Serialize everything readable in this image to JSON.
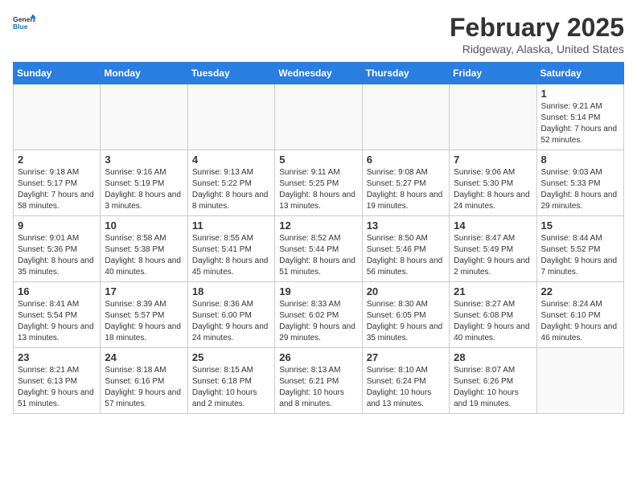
{
  "header": {
    "logo_general": "General",
    "logo_blue": "Blue",
    "month_year": "February 2025",
    "location": "Ridgeway, Alaska, United States"
  },
  "days_of_week": [
    "Sunday",
    "Monday",
    "Tuesday",
    "Wednesday",
    "Thursday",
    "Friday",
    "Saturday"
  ],
  "weeks": [
    [
      {
        "day": "",
        "info": ""
      },
      {
        "day": "",
        "info": ""
      },
      {
        "day": "",
        "info": ""
      },
      {
        "day": "",
        "info": ""
      },
      {
        "day": "",
        "info": ""
      },
      {
        "day": "",
        "info": ""
      },
      {
        "day": "1",
        "info": "Sunrise: 9:21 AM\nSunset: 5:14 PM\nDaylight: 7 hours and 52 minutes."
      }
    ],
    [
      {
        "day": "2",
        "info": "Sunrise: 9:18 AM\nSunset: 5:17 PM\nDaylight: 7 hours and 58 minutes."
      },
      {
        "day": "3",
        "info": "Sunrise: 9:16 AM\nSunset: 5:19 PM\nDaylight: 8 hours and 3 minutes."
      },
      {
        "day": "4",
        "info": "Sunrise: 9:13 AM\nSunset: 5:22 PM\nDaylight: 8 hours and 8 minutes."
      },
      {
        "day": "5",
        "info": "Sunrise: 9:11 AM\nSunset: 5:25 PM\nDaylight: 8 hours and 13 minutes."
      },
      {
        "day": "6",
        "info": "Sunrise: 9:08 AM\nSunset: 5:27 PM\nDaylight: 8 hours and 19 minutes."
      },
      {
        "day": "7",
        "info": "Sunrise: 9:06 AM\nSunset: 5:30 PM\nDaylight: 8 hours and 24 minutes."
      },
      {
        "day": "8",
        "info": "Sunrise: 9:03 AM\nSunset: 5:33 PM\nDaylight: 8 hours and 29 minutes."
      }
    ],
    [
      {
        "day": "9",
        "info": "Sunrise: 9:01 AM\nSunset: 5:36 PM\nDaylight: 8 hours and 35 minutes."
      },
      {
        "day": "10",
        "info": "Sunrise: 8:58 AM\nSunset: 5:38 PM\nDaylight: 8 hours and 40 minutes."
      },
      {
        "day": "11",
        "info": "Sunrise: 8:55 AM\nSunset: 5:41 PM\nDaylight: 8 hours and 45 minutes."
      },
      {
        "day": "12",
        "info": "Sunrise: 8:52 AM\nSunset: 5:44 PM\nDaylight: 8 hours and 51 minutes."
      },
      {
        "day": "13",
        "info": "Sunrise: 8:50 AM\nSunset: 5:46 PM\nDaylight: 8 hours and 56 minutes."
      },
      {
        "day": "14",
        "info": "Sunrise: 8:47 AM\nSunset: 5:49 PM\nDaylight: 9 hours and 2 minutes."
      },
      {
        "day": "15",
        "info": "Sunrise: 8:44 AM\nSunset: 5:52 PM\nDaylight: 9 hours and 7 minutes."
      }
    ],
    [
      {
        "day": "16",
        "info": "Sunrise: 8:41 AM\nSunset: 5:54 PM\nDaylight: 9 hours and 13 minutes."
      },
      {
        "day": "17",
        "info": "Sunrise: 8:39 AM\nSunset: 5:57 PM\nDaylight: 9 hours and 18 minutes."
      },
      {
        "day": "18",
        "info": "Sunrise: 8:36 AM\nSunset: 6:00 PM\nDaylight: 9 hours and 24 minutes."
      },
      {
        "day": "19",
        "info": "Sunrise: 8:33 AM\nSunset: 6:02 PM\nDaylight: 9 hours and 29 minutes."
      },
      {
        "day": "20",
        "info": "Sunrise: 8:30 AM\nSunset: 6:05 PM\nDaylight: 9 hours and 35 minutes."
      },
      {
        "day": "21",
        "info": "Sunrise: 8:27 AM\nSunset: 6:08 PM\nDaylight: 9 hours and 40 minutes."
      },
      {
        "day": "22",
        "info": "Sunrise: 8:24 AM\nSunset: 6:10 PM\nDaylight: 9 hours and 46 minutes."
      }
    ],
    [
      {
        "day": "23",
        "info": "Sunrise: 8:21 AM\nSunset: 6:13 PM\nDaylight: 9 hours and 51 minutes."
      },
      {
        "day": "24",
        "info": "Sunrise: 8:18 AM\nSunset: 6:16 PM\nDaylight: 9 hours and 57 minutes."
      },
      {
        "day": "25",
        "info": "Sunrise: 8:15 AM\nSunset: 6:18 PM\nDaylight: 10 hours and 2 minutes."
      },
      {
        "day": "26",
        "info": "Sunrise: 8:13 AM\nSunset: 6:21 PM\nDaylight: 10 hours and 8 minutes."
      },
      {
        "day": "27",
        "info": "Sunrise: 8:10 AM\nSunset: 6:24 PM\nDaylight: 10 hours and 13 minutes."
      },
      {
        "day": "28",
        "info": "Sunrise: 8:07 AM\nSunset: 6:26 PM\nDaylight: 10 hours and 19 minutes."
      },
      {
        "day": "",
        "info": ""
      }
    ]
  ]
}
